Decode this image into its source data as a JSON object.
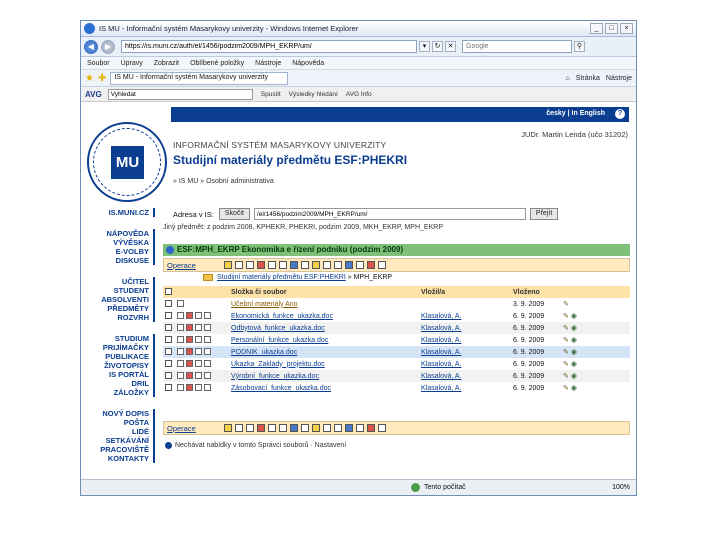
{
  "window": {
    "title": "IS MU - Informační systém Masarykovy univerzity - Windows Internet Explorer",
    "controls": [
      "_",
      "□",
      "×"
    ]
  },
  "address_bar": {
    "url": "https://is.muni.cz/auth/el/1456/podzim2009/MPH_EKRP/um/",
    "search_placeholder": "Google"
  },
  "menu": [
    "Soubor",
    "Úpravy",
    "Zobrazit",
    "Oblíbené položky",
    "Nástroje",
    "Nápověda"
  ],
  "favorites_bar": {
    "tab": "IS MU - Informační systém Masarykovy univerzity",
    "right": [
      "Stránka",
      "Nástroje"
    ]
  },
  "avg_toolbar": {
    "logo": "AVG",
    "input_value": "Vyhledat",
    "items": [
      "Spustit",
      "Výsledky hledání",
      "AVG Info"
    ]
  },
  "header": {
    "languages": "česky | In English",
    "help": "?",
    "user": "JUDr. Martin Lenda (učo 31202)",
    "system_name": "INFORMAČNÍ SYSTÉM MASARYKOVY UNIVERZITY",
    "page_title": "Studijní materiály předmětu ESF:PHEKRI",
    "breadcrumb": "» IS MU » Osobní administrativa",
    "seal_text": "MU"
  },
  "sidebar": {
    "groups": [
      [
        "IS.MUNI.CZ"
      ],
      [
        "NÁPOVĚDA",
        "VÝVĚSKA",
        "E-VOLBY",
        "DISKUSE"
      ],
      [
        "UČITEL",
        "STUDENT",
        "ABSOLVENTI",
        "PŘEDMĚTY",
        "ROZVRH"
      ],
      [
        "STUDIUM",
        "PRIJÍMAČKY",
        "PUBLIKACE",
        "ŽIVOTOPISY",
        "IS PORTÁL",
        "DRIL",
        "ZÁLOŽKY"
      ],
      [
        "NOVÝ DOPIS",
        "POŠTA",
        "LIDÉ",
        "SETKÁVÁNÍ",
        "PRACOVIŠTĚ",
        "KONTAKTY"
      ]
    ]
  },
  "address_form": {
    "label": "Adresa v IS:",
    "back_label": "Skočit",
    "value": "/el/1456/podzim2009/MPH_EKRP/um/",
    "go_label": "Přejít"
  },
  "period_line": "Jiný předmět: z podzim 2008, KPHEKR, PHEKRI, podzim 2009, MKH_EKRP, MPH_EKRP",
  "course": {
    "title": "ESF:MPH_EKRP Ekonomika e řízení podniku (podzim 2009)"
  },
  "operations": {
    "label": "Operace"
  },
  "folder_path": {
    "root": "Studijní materiály předmětu ESF:PHEKRI",
    "current": "MPH_EKRP"
  },
  "table": {
    "columns": [
      "Složka či soubor",
      "Vložil/a",
      "Vloženo"
    ],
    "parent": {
      "name": "Učební materiály Ano",
      "date": "3. 9. 2009"
    },
    "rows": [
      {
        "name": "Ekonomická_funkce_ukazka.doc",
        "owner": "Klasalová, A.",
        "date": "6. 9. 2009",
        "style": ""
      },
      {
        "name": "Odbytová_funkce_ukazka.doc",
        "owner": "Klasalová, A.",
        "date": "6. 9. 2009",
        "style": "alt"
      },
      {
        "name": "Personální_funkce_ukazka.doc",
        "owner": "Klasalová, A.",
        "date": "6. 9. 2009",
        "style": ""
      },
      {
        "name": "PODNIK_ukazka.doc",
        "owner": "Klasalová, A.",
        "date": "6. 9. 2009",
        "style": "hl"
      },
      {
        "name": "Ukazka_Zaklady_projektu.doc",
        "owner": "Klasalová, A.",
        "date": "6. 9. 2009",
        "style": ""
      },
      {
        "name": "Výrobní_funkce_ukazka.doc",
        "owner": "Klasalová, A.",
        "date": "6. 9. 2009",
        "style": "alt"
      },
      {
        "name": "Zásobovací_funkce_ukazka.doc",
        "owner": "Klasalová, A.",
        "date": "6. 9. 2009",
        "style": ""
      }
    ]
  },
  "footer_line": "Nechávat nabídky v tomto Správci souborů  ·  Nastavení",
  "statusbar": {
    "zone": "Tento počítač",
    "zoom": "100%"
  }
}
